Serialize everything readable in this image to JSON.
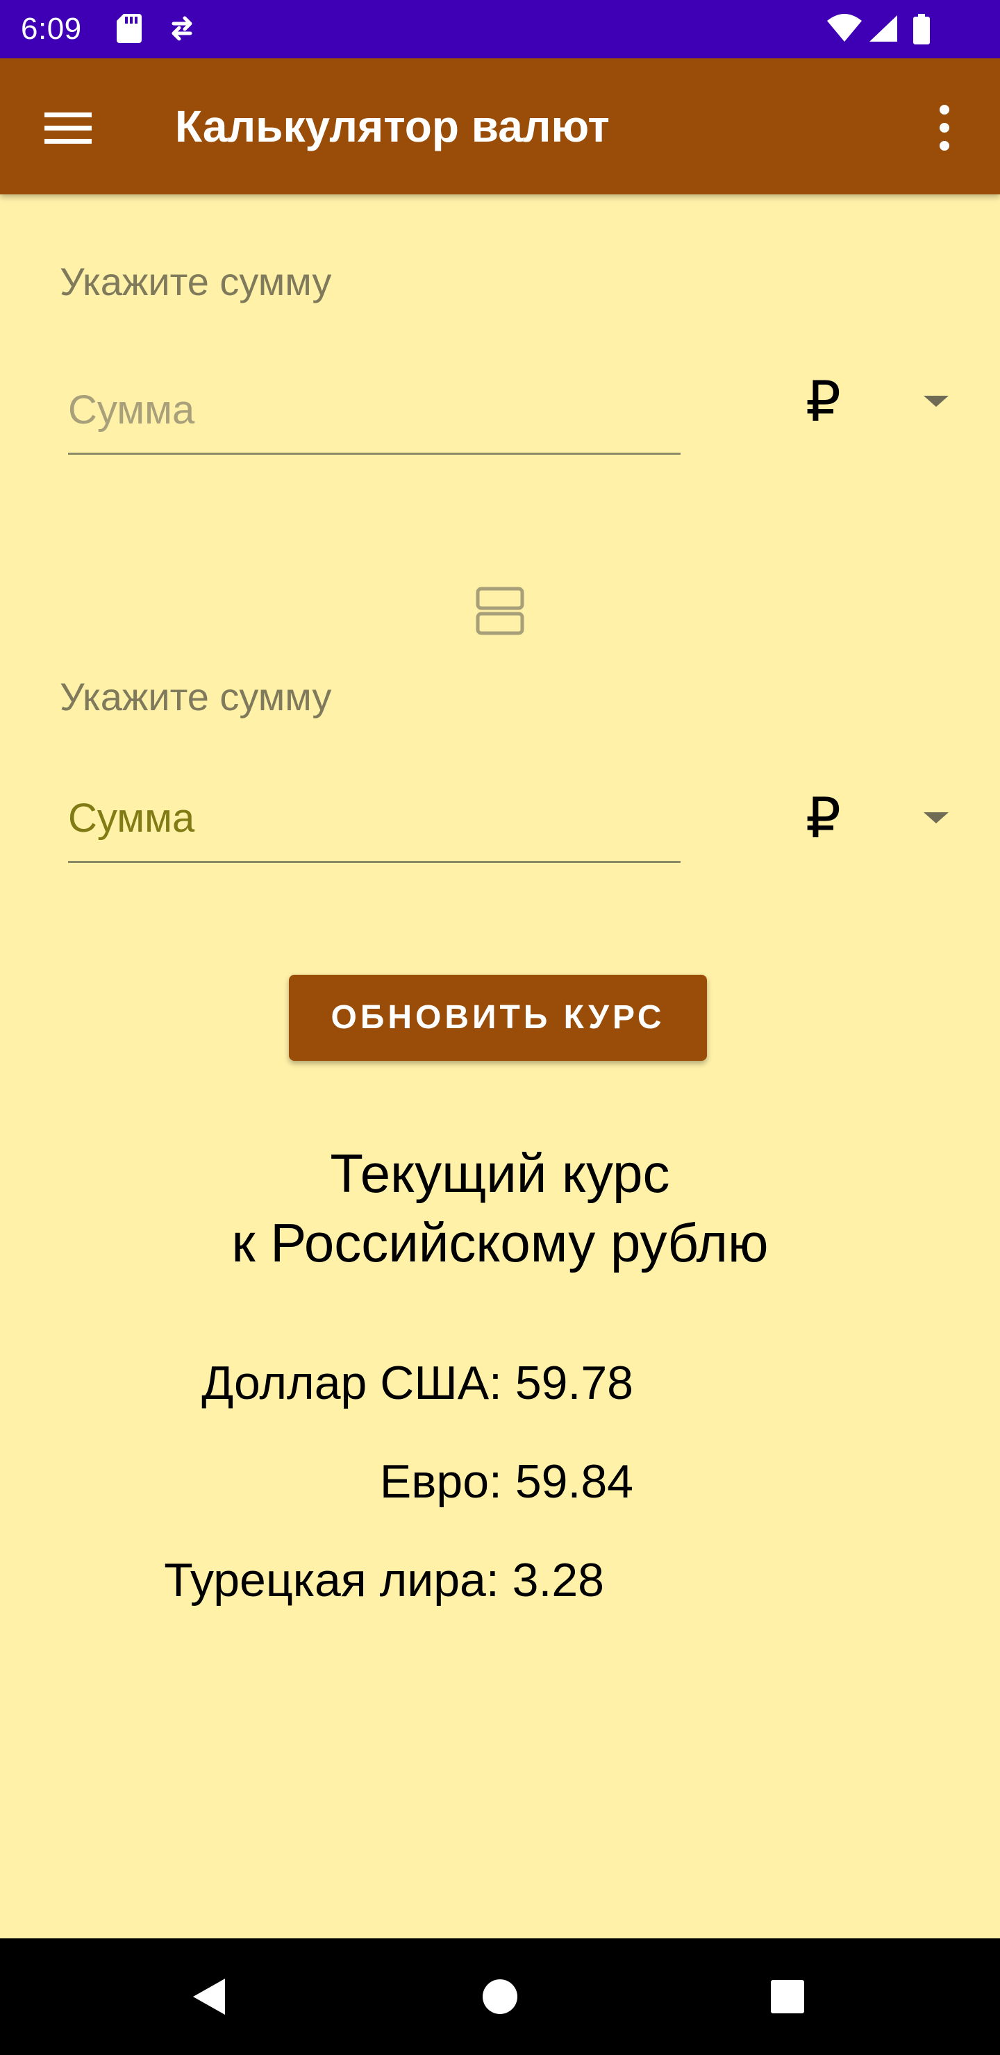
{
  "status_bar": {
    "time": "6:09",
    "left_icons": [
      "sd-card-icon",
      "sync-icon"
    ],
    "right_icons": [
      "wifi-icon",
      "cellular-signal-icon",
      "battery-icon"
    ],
    "background_color": "#3F00B5"
  },
  "app_bar": {
    "title": "Калькулятор валют",
    "menu_icon": "hamburger-menu-icon",
    "more_icon": "more-vert-icon",
    "background_color": "#994D08"
  },
  "form": {
    "first": {
      "label": "Укажите сумму",
      "input_placeholder": "Сумма",
      "input_value": "",
      "currency": "₽"
    },
    "swap_icon": "swap-icon",
    "second": {
      "label": "Укажите сумму",
      "input_placeholder": "Сумма",
      "input_value": "",
      "currency": "₽"
    }
  },
  "update_button": {
    "label": "ОБНОВИТЬ КУРС"
  },
  "rates": {
    "heading_line1": "Текущий курс",
    "heading_line2": "к Российскому рублю",
    "items": [
      {
        "text": "Доллар США: 59.78"
      },
      {
        "text": "Евро: 59.84"
      },
      {
        "text": "Турецкая лира: 3.28"
      }
    ]
  },
  "nav_bar": {
    "icons": [
      "back-icon",
      "home-icon",
      "recents-icon"
    ]
  },
  "colors": {
    "background": "#FFF1A8",
    "accent": "#994D08",
    "status_bar": "#3F00B5"
  }
}
